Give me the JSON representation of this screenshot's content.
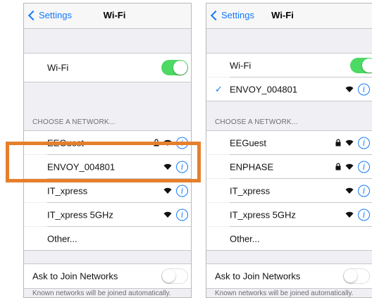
{
  "left": {
    "nav": {
      "back": "Settings",
      "title": "Wi-Fi"
    },
    "wifi_label": "Wi-Fi",
    "wifi_on": true,
    "section_header": "CHOOSE A NETWORK...",
    "networks": [
      {
        "name": "EEGuest",
        "lock": true
      },
      {
        "name": "ENVOY_004801",
        "lock": false
      },
      {
        "name": "IT_xpress",
        "lock": false
      },
      {
        "name": "IT_xpress 5GHz",
        "lock": false
      }
    ],
    "other": "Other...",
    "ask_label": "Ask to Join Networks",
    "ask_on": false,
    "footer": "Known networks will be joined automatically."
  },
  "right": {
    "nav": {
      "back": "Settings",
      "title": "Wi-Fi"
    },
    "wifi_label": "Wi-Fi",
    "wifi_on": true,
    "connected": "ENVOY_004801",
    "section_header": "CHOOSE A NETWORK...",
    "networks": [
      {
        "name": "EEGuest",
        "lock": true
      },
      {
        "name": "ENPHASE",
        "lock": true
      },
      {
        "name": "IT_xpress",
        "lock": false
      },
      {
        "name": "IT_xpress 5GHz",
        "lock": false
      }
    ],
    "other": "Other...",
    "ask_label": "Ask to Join Networks",
    "ask_on": false,
    "footer": "Known networks will be joined automatically."
  },
  "colors": {
    "accent": "#1479fb",
    "toggle_on": "#4cd964",
    "highlight": "#e67f2c"
  },
  "icons": {
    "lock": "lock-icon",
    "wifi": "wifi-signal-icon",
    "info": "info-icon"
  }
}
